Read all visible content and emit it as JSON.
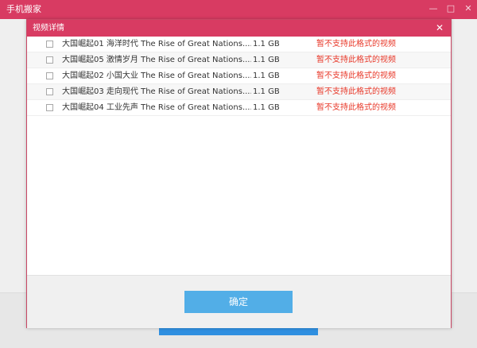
{
  "app": {
    "title": "手机搬家",
    "controls": [
      "—",
      "□",
      "✕"
    ]
  },
  "dialog": {
    "title": "视频详情",
    "close_label": "✕",
    "ok_label": "确定"
  },
  "videos": [
    {
      "name": "大国崛起01 海洋时代 The Rise of Great Nations....",
      "size": "1.1 GB",
      "status": "暂不支持此格式的视频"
    },
    {
      "name": "大国崛起05 激情岁月 The Rise of Great Nations....",
      "size": "1.1 GB",
      "status": "暂不支持此格式的视频"
    },
    {
      "name": "大国崛起02 小国大业 The Rise of Great Nations....",
      "size": "1.1 GB",
      "status": "暂不支持此格式的视频"
    },
    {
      "name": "大国崛起03 走向现代 The Rise of Great Nations....",
      "size": "1.1 GB",
      "status": "暂不支持此格式的视频"
    },
    {
      "name": "大国崛起04 工业先声 The Rise of Great Nations....",
      "size": "1.1 GB",
      "status": "暂不支持此格式的视频"
    }
  ],
  "colors": {
    "accent": "#d83b62",
    "button": "#52aee7",
    "error_text": "#e8392a"
  }
}
